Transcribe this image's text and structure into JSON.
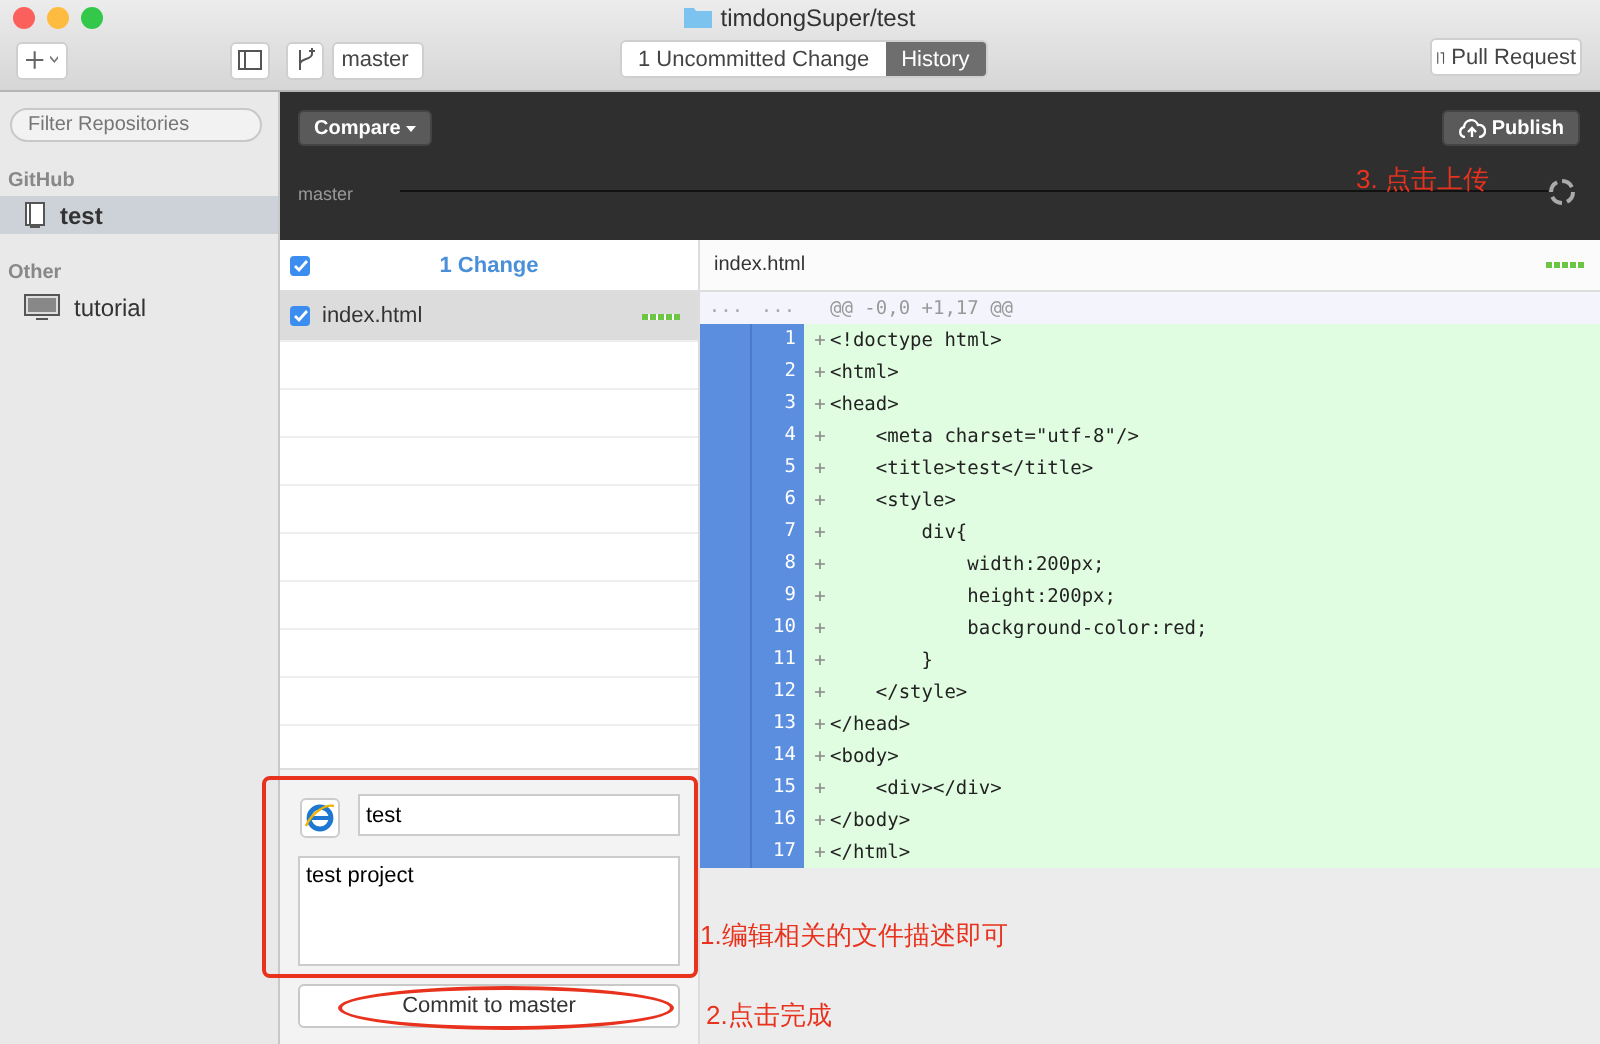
{
  "window": {
    "title": "timdongSuper/test"
  },
  "toolbar": {
    "branch": "master",
    "tabs": [
      {
        "label": "1 Uncommitted Change",
        "selected": false
      },
      {
        "label": "History",
        "selected": true
      }
    ],
    "pull_request": "Pull Request"
  },
  "sidebar": {
    "filter_placeholder": "Filter Repositories",
    "groups": [
      {
        "title": "GitHub",
        "items": [
          {
            "name": "test",
            "kind": "repository",
            "selected": true
          }
        ]
      },
      {
        "title": "Other",
        "items": [
          {
            "name": "tutorial",
            "kind": "computer",
            "selected": false
          }
        ]
      }
    ]
  },
  "header": {
    "compare": "Compare",
    "publish": "Publish",
    "branch_label": "master"
  },
  "changes": {
    "all_checked": true,
    "title": "1 Change",
    "files": [
      {
        "name": "index.html",
        "checked": true,
        "selected": true
      }
    ]
  },
  "diff": {
    "file": "index.html",
    "old_marker": "...",
    "new_marker": "...",
    "hunk": "@@ -0,0 +1,17 @@",
    "lines": [
      {
        "number": "1",
        "sign": "+",
        "text": "<!doctype html>"
      },
      {
        "number": "2",
        "sign": "+",
        "text": "<html>"
      },
      {
        "number": "3",
        "sign": "+",
        "text": "<head>"
      },
      {
        "number": "4",
        "sign": "+",
        "text": "    <meta charset=\"utf-8\"/>"
      },
      {
        "number": "5",
        "sign": "+",
        "text": "    <title>test</title>"
      },
      {
        "number": "6",
        "sign": "+",
        "text": "    <style>"
      },
      {
        "number": "7",
        "sign": "+",
        "text": "        div{"
      },
      {
        "number": "8",
        "sign": "+",
        "text": "            width:200px;"
      },
      {
        "number": "9",
        "sign": "+",
        "text": "            height:200px;"
      },
      {
        "number": "10",
        "sign": "+",
        "text": "            background-color:red;"
      },
      {
        "number": "11",
        "sign": "+",
        "text": "        }"
      },
      {
        "number": "12",
        "sign": "+",
        "text": "    </style>"
      },
      {
        "number": "13",
        "sign": "+",
        "text": "</head>"
      },
      {
        "number": "14",
        "sign": "+",
        "text": "<body>"
      },
      {
        "number": "15",
        "sign": "+",
        "text": "    <div></div>"
      },
      {
        "number": "16",
        "sign": "+",
        "text": "</body>"
      },
      {
        "number": "17",
        "sign": "+",
        "text": "</html>"
      }
    ]
  },
  "commit": {
    "summary": "test",
    "description": "test project",
    "button": "Commit to master"
  },
  "annotations": [
    {
      "kind": "upload",
      "text": "3. 点击上传"
    },
    {
      "kind": "describe",
      "text": "1.编辑相关的文件描述即可"
    },
    {
      "kind": "finish",
      "text": "2.点击完成"
    }
  ]
}
